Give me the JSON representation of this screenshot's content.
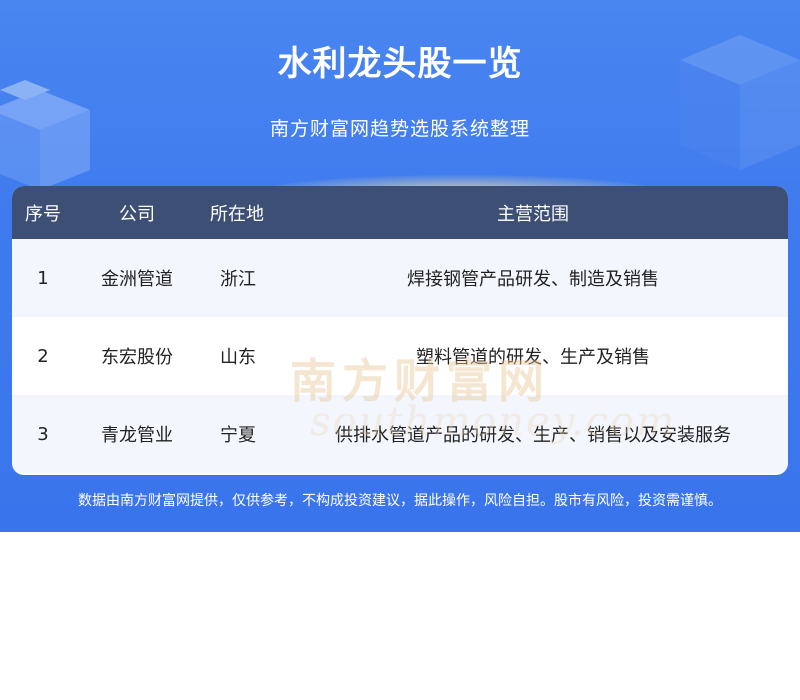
{
  "header": {
    "title": "水利龙头股一览",
    "subtitle": "南方财富网趋势选股系统整理"
  },
  "table": {
    "columns": [
      "序号",
      "公司",
      "所在地",
      "主营范围"
    ],
    "rows": [
      {
        "no": "1",
        "company": "金洲管道",
        "location": "浙江",
        "business": "焊接钢管产品研发、制造及销售"
      },
      {
        "no": "2",
        "company": "东宏股份",
        "location": "山东",
        "business": "塑料管道的研发、生产及销售"
      },
      {
        "no": "3",
        "company": "青龙管业",
        "location": "宁夏",
        "business": "供排水管道产品的研发、生产、销售以及安装服务"
      }
    ]
  },
  "watermark": {
    "text": "南方财富网",
    "sub": "southmoney.com"
  },
  "footer": {
    "disclaimer": "数据由南方财富网提供，仅供参考，不构成投资建议，据此操作，风险自担。股市有风险，投资需谨慎。"
  },
  "colors": {
    "banner": "#3f7bee",
    "table_header": "#3d4f74",
    "row_alt": "#f3f6fd"
  }
}
